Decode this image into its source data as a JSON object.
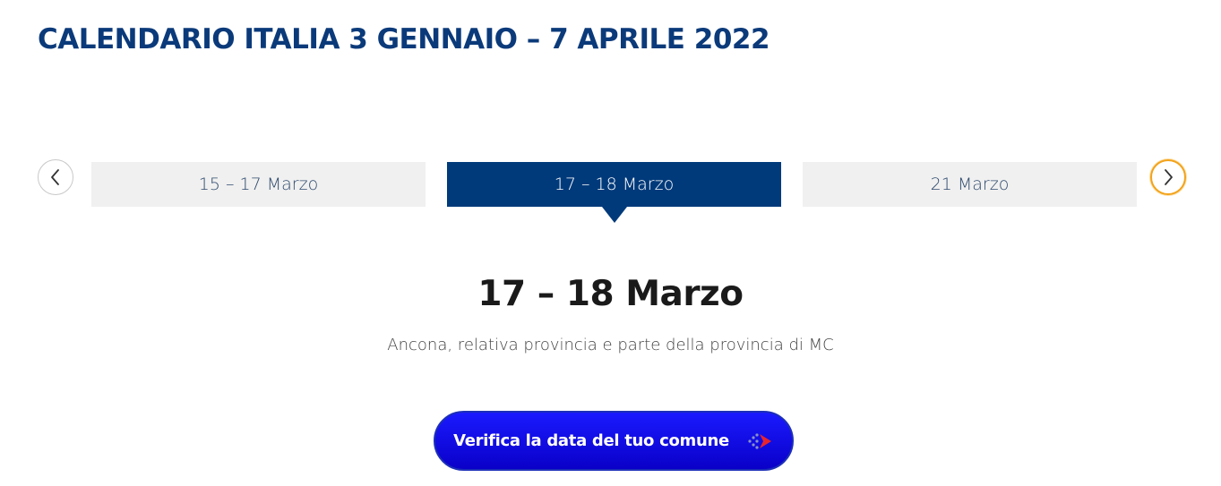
{
  "page": {
    "title": "CALENDARIO ITALIA 3 GENNAIO – 7 APRILE 2022"
  },
  "carousel": {
    "prev_icon": "chevron-left-icon",
    "next_icon": "chevron-right-icon",
    "tabs": [
      {
        "label": "15 – 17 Marzo",
        "active": false
      },
      {
        "label": "17 – 18 Marzo",
        "active": true
      },
      {
        "label": "21 Marzo",
        "active": false
      }
    ]
  },
  "detail": {
    "heading": "17 – 18 Marzo",
    "description": "Ancona, relativa provincia e parte della provincia di MC"
  },
  "cta": {
    "label": "Verifica la data del tuo comune",
    "icon": "arrow-forward-icon"
  },
  "colors": {
    "brand_blue": "#003a7a",
    "title_blue": "#0b3a7a",
    "cta_blue": "#0a00c8",
    "focus_ring": "#f2a31b",
    "tab_inactive_bg": "#f0f0f0"
  }
}
